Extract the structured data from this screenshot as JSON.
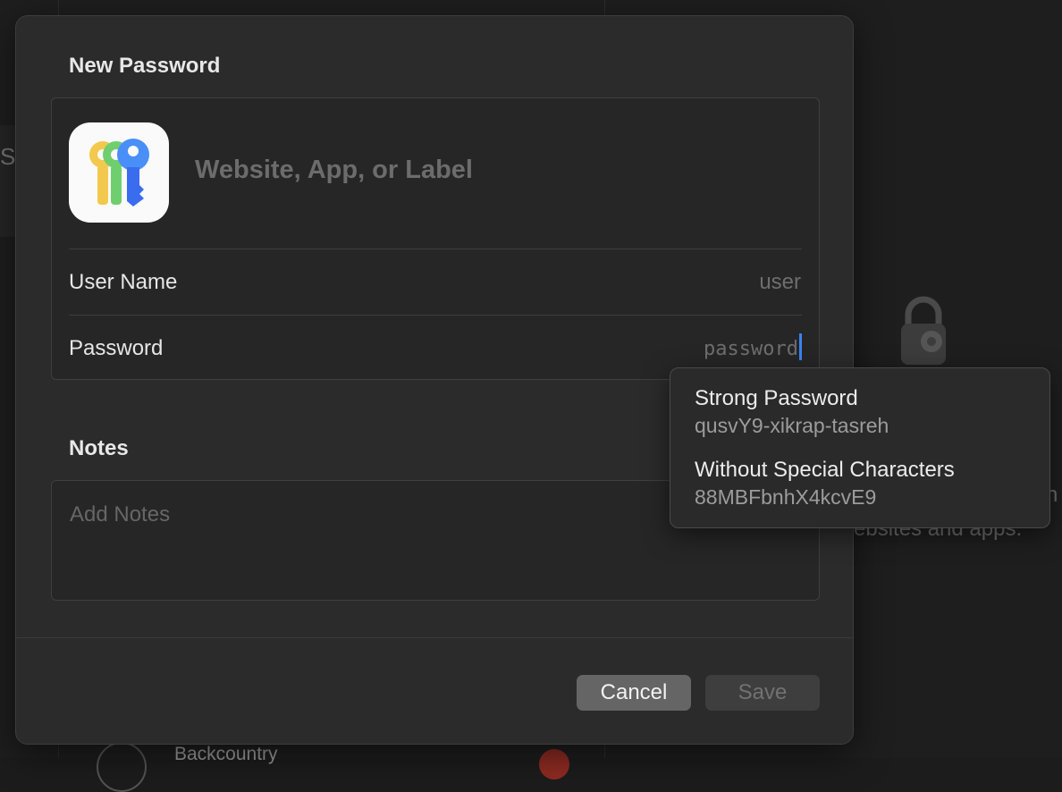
{
  "background": {
    "row_initial": "S",
    "empty_state_text": "ebsites and apps.",
    "empty_state_tail": "h",
    "bottom_item": "Backcountry"
  },
  "sheet": {
    "title": "New Password",
    "label_placeholder": "Website, App, or Label",
    "user_name_label": "User Name",
    "user_name_value": "user",
    "password_label": "Password",
    "password_value": "password",
    "notes_title": "Notes",
    "notes_placeholder": "Add Notes",
    "cancel_label": "Cancel",
    "save_label": "Save"
  },
  "suggestions": {
    "items": [
      {
        "title": "Strong Password",
        "value": "qusvY9-xikrap-tasreh"
      },
      {
        "title": "Without Special Characters",
        "value": "88MBFbnhX4kcvE9"
      }
    ]
  },
  "colors": {
    "accent": "#3a82f7",
    "sheet_bg": "#2b2b2b",
    "cancel_bg": "#656565"
  },
  "icons": {
    "app_icon": "passwords-keys-icon",
    "background_icon": "lock-keys-icon"
  }
}
